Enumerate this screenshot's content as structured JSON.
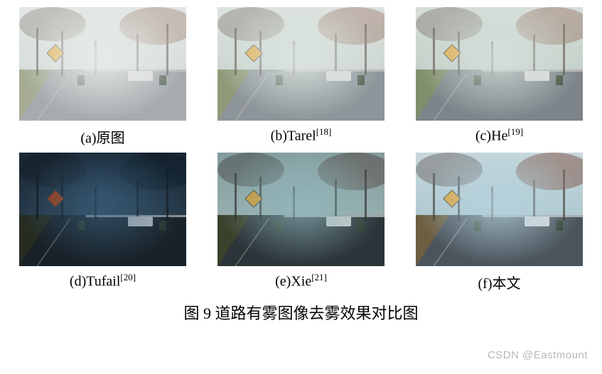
{
  "figure": {
    "number": "图 9",
    "title": "道路有雾图像去雾效果对比图",
    "full_caption": "图 9 道路有雾图像去雾效果对比图"
  },
  "panels": [
    {
      "id": "a",
      "label_prefix": "(a)",
      "label_text": "原图",
      "label_full": "(a)原图",
      "citation": "",
      "variant": "variant-a"
    },
    {
      "id": "b",
      "label_prefix": "(b)",
      "label_text": "Tarel",
      "label_full": "(b)Tarel",
      "citation": "[18]",
      "variant": "variant-b"
    },
    {
      "id": "c",
      "label_prefix": "(c)",
      "label_text": "He",
      "label_full": "(c)He",
      "citation": "[19]",
      "variant": "variant-c"
    },
    {
      "id": "d",
      "label_prefix": "(d)",
      "label_text": "Tufail",
      "label_full": "(d)Tufail",
      "citation": "[20]",
      "variant": "variant-d"
    },
    {
      "id": "e",
      "label_prefix": "(e)",
      "label_text": "Xie",
      "label_full": "(e)Xie",
      "citation": "[21]",
      "variant": "variant-e"
    },
    {
      "id": "f",
      "label_prefix": "(f)",
      "label_text": "本文",
      "label_full": "(f)本文",
      "citation": "",
      "variant": "variant-f"
    }
  ],
  "watermark": "CSDN @Eastmount"
}
